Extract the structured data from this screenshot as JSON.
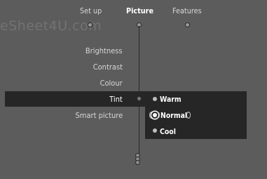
{
  "watermark": "eSheet4U.com",
  "tabs": [
    {
      "label": "Set up"
    },
    {
      "label": "Picture"
    },
    {
      "label": "Features"
    }
  ],
  "menu": {
    "items": [
      {
        "label": "Brightness"
      },
      {
        "label": "Contrast"
      },
      {
        "label": "Colour"
      },
      {
        "label": "Tint"
      },
      {
        "label": "Smart picture"
      }
    ]
  },
  "submenu": {
    "options": [
      {
        "label": "Warm"
      },
      {
        "label": "Normal"
      },
      {
        "label": "Cool"
      }
    ],
    "selected": "Normal"
  }
}
